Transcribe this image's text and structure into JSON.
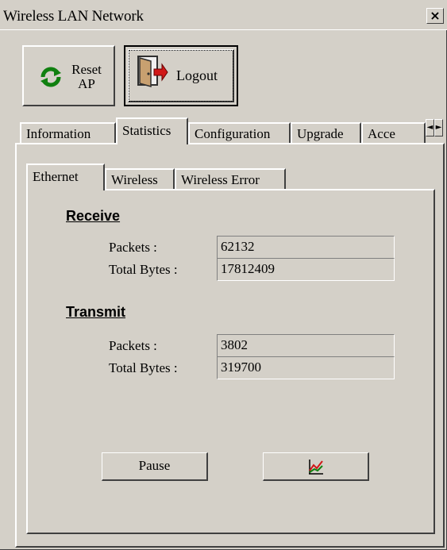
{
  "window": {
    "title": "Wireless LAN Network",
    "close_glyph": "×"
  },
  "toolbar": {
    "reset_label_line1": "Reset",
    "reset_label_line2": "AP",
    "reset_icon": "refresh-icon",
    "logout_label": "Logout",
    "logout_icon": "door-exit-icon"
  },
  "tabs": [
    {
      "label": "Information",
      "active": false
    },
    {
      "label": "Statistics",
      "active": true
    },
    {
      "label": "Configuration",
      "active": false
    },
    {
      "label": "Upgrade",
      "active": false
    },
    {
      "label": "Acce",
      "active": false
    }
  ],
  "tab_scroll": {
    "left": "◄",
    "right": "►"
  },
  "subtabs": [
    {
      "label": "Ethernet",
      "active": true
    },
    {
      "label": "Wireless",
      "active": false
    },
    {
      "label": "Wireless Error",
      "active": false
    }
  ],
  "receive": {
    "title": "Receive",
    "packets_label": "Packets :",
    "packets_value": "62132",
    "bytes_label": "Total Bytes :",
    "bytes_value": "17812409"
  },
  "transmit": {
    "title": "Transmit",
    "packets_label": "Packets :",
    "packets_value": "3802",
    "bytes_label": "Total Bytes :",
    "bytes_value": "319700"
  },
  "buttons": {
    "pause_label": "Pause",
    "chart_icon": "chart-icon"
  },
  "colors": {
    "face": "#d4d0c8",
    "shadow": "#404040",
    "highlight": "#ffffff"
  }
}
